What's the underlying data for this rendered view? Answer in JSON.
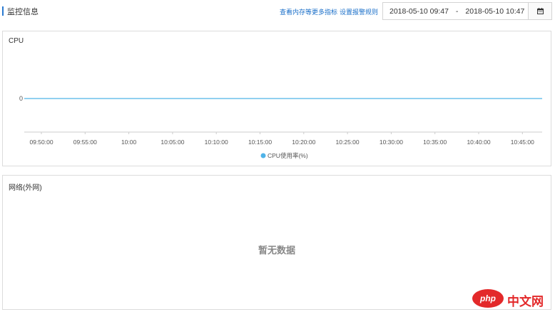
{
  "header": {
    "title": "监控信息",
    "links": [
      "查看内存等更多指标",
      "设置报警规则"
    ],
    "date_start": "2018-05-10 09:47",
    "date_sep": "-",
    "date_end": "2018-05-10 10:47"
  },
  "cpu_panel": {
    "title": "CPU"
  },
  "network_panel": {
    "title": "网络(外网)",
    "empty_text": "暂无数据"
  },
  "watermark": {
    "text": "中文网",
    "logo_text": "php"
  },
  "colors": {
    "accent": "#2a7ad1",
    "series": "#4fb3e8",
    "axis": "#cccccc"
  },
  "chart_data": {
    "type": "line",
    "title": "CPU",
    "xlabel": "",
    "ylabel": "",
    "x": [
      "09:50:00",
      "09:55:00",
      "10:00",
      "10:05:00",
      "10:10:00",
      "10:15:00",
      "10:20:00",
      "10:25:00",
      "10:30:00",
      "10:35:00",
      "10:40:00",
      "10:45:00"
    ],
    "y_ticks": [
      "0"
    ],
    "series": [
      {
        "name": "CPU使用率(%)",
        "values": [
          0,
          0,
          0,
          0,
          0,
          0,
          0,
          0,
          0,
          0,
          0,
          0
        ]
      }
    ],
    "legend": "bottom-center",
    "grid": false
  }
}
